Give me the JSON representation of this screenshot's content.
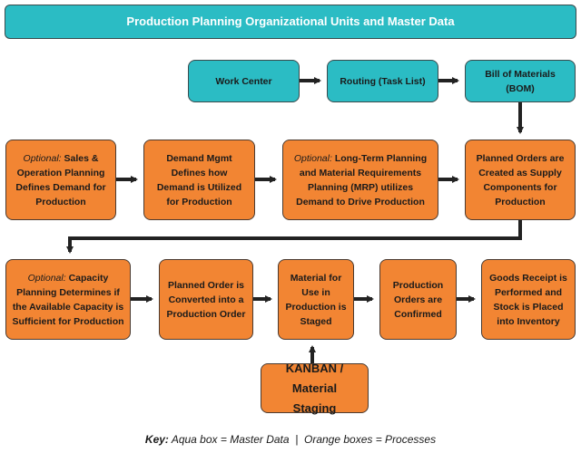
{
  "title": "Production Planning Organizational Units and Master Data",
  "colors": {
    "master_data": "#2bbcc4",
    "process": "#f28533",
    "arrow": "#222222"
  },
  "master_data": [
    {
      "label": "Work Center"
    },
    {
      "label": "Routing (Task List)"
    },
    {
      "label": "Bill of Materials (BOM)"
    }
  ],
  "row2": [
    {
      "prefix": "Optional:",
      "label": "Sales & Operation Planning Defines Demand for Production"
    },
    {
      "prefix": "",
      "label": "Demand Mgmt Defines how Demand is Utilized for Production"
    },
    {
      "prefix": "Optional:",
      "label": "Long-Term Planning and Material Requirements Planning (MRP) utilizes Demand to Drive Production"
    },
    {
      "prefix": "",
      "label": "Planned Orders are Created as Supply Components for Production"
    }
  ],
  "row3": [
    {
      "prefix": "Optional:",
      "label": "Capacity Planning Determines if the Available Capacity is Sufficient for Production"
    },
    {
      "prefix": "",
      "label": "Planned Order is Converted into a Production Order"
    },
    {
      "prefix": "",
      "label": "Material for Use in Production is Staged"
    },
    {
      "prefix": "",
      "label": "Production Orders are Confirmed"
    },
    {
      "prefix": "",
      "label": "Goods Receipt is Performed and Stock is Placed into Inventory"
    }
  ],
  "kanban": {
    "label": "KANBAN / Material Staging"
  },
  "key": {
    "prefix": "Key:",
    "text": "Aqua box = Master Data  |  Orange boxes = Processes"
  }
}
